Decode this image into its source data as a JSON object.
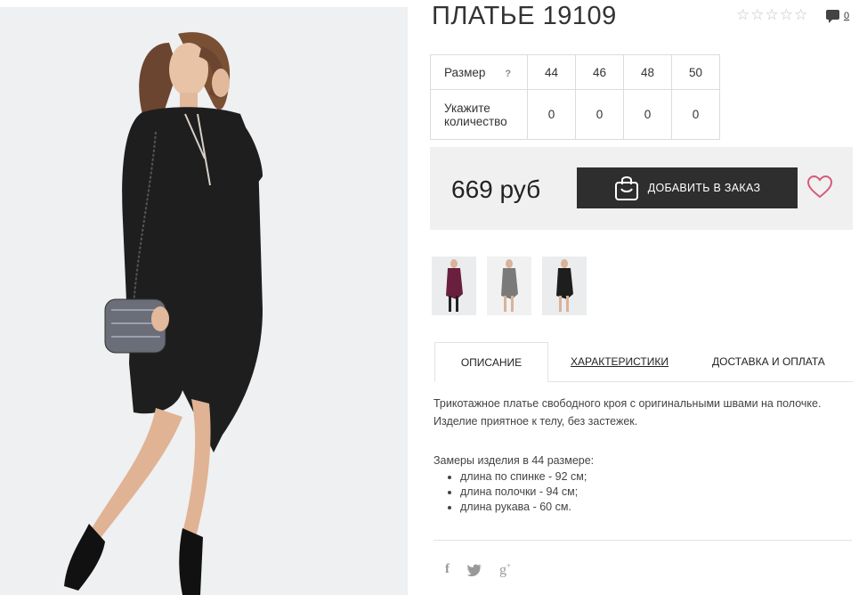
{
  "product": {
    "title": "ПЛАТЬЕ 19109"
  },
  "rating": {
    "stars_total": 5,
    "stars_filled": 0,
    "comments_count": "0"
  },
  "size_table": {
    "size_label": "Размер",
    "help_mark": "?",
    "sizes": [
      "44",
      "46",
      "48",
      "50"
    ],
    "quantity_label": "Укажите количество",
    "quantities": [
      "0",
      "0",
      "0",
      "0"
    ]
  },
  "purchase": {
    "price": "669 руб",
    "order_button": "ДОБАВИТЬ В ЗАКАЗ"
  },
  "thumbnails": [
    {
      "name": "burgundy-dress"
    },
    {
      "name": "grey-dress"
    },
    {
      "name": "black-dress"
    }
  ],
  "tabs": {
    "description": "ОПИСАНИЕ",
    "specs": "ХАРАКТЕРИСТИКИ",
    "delivery": "ДОСТАВКА И ОПЛАТА"
  },
  "description": {
    "paragraph_1": "Трикотажное платье свободного кроя с оригинальными швами на полочке.",
    "paragraph_2": "Изделие приятное к телу, без застежек.",
    "measurements_title": "Замеры изделия в 44 размере:",
    "items": [
      "длина по спинке - 92 см;",
      "длина полочки - 94 см;",
      "длина рукава - 60 см."
    ]
  },
  "social": {
    "facebook": "f",
    "twitter": "twitter-bird",
    "gplus": "g+"
  },
  "colors": {
    "button_bg": "#2e2e2e",
    "heart": "#d45a7a",
    "price_box_bg": "#f0f0f0",
    "photo_bg": "#eef0f1"
  }
}
